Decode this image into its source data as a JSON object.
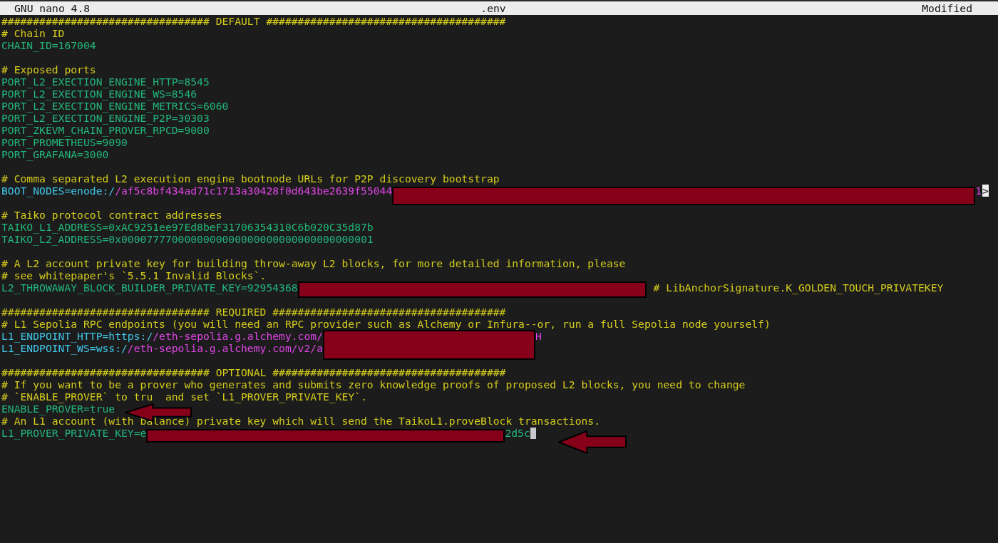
{
  "title_bar": {
    "app": "GNU nano 4.8",
    "file": ".env",
    "status": "Modified"
  },
  "lines": [
    {
      "kind": "text",
      "segments": [
        {
          "kind": "comment",
          "text": "################################# DEFAULT ######################################"
        }
      ]
    },
    {
      "kind": "text",
      "segments": [
        {
          "kind": "comment",
          "text": "# Chain ID"
        }
      ]
    },
    {
      "kind": "text",
      "segments": [
        {
          "kind": "setting",
          "text": "CHAIN_ID=167004"
        }
      ]
    },
    {
      "kind": "blank"
    },
    {
      "kind": "text",
      "segments": [
        {
          "kind": "comment",
          "text": "# Exposed ports"
        }
      ]
    },
    {
      "kind": "text",
      "segments": [
        {
          "kind": "setting",
          "text": "PORT_L2_EXECTION_ENGINE_HTTP=8545"
        }
      ]
    },
    {
      "kind": "text",
      "segments": [
        {
          "kind": "setting",
          "text": "PORT_L2_EXECTION_ENGINE_WS=8546"
        }
      ]
    },
    {
      "kind": "text",
      "segments": [
        {
          "kind": "setting",
          "text": "PORT_L2_EXECTION_ENGINE_METRICS=6060"
        }
      ]
    },
    {
      "kind": "text",
      "segments": [
        {
          "kind": "setting",
          "text": "PORT_L2_EXECTION_ENGINE_P2P=30303"
        }
      ]
    },
    {
      "kind": "text",
      "segments": [
        {
          "kind": "setting",
          "text": "PORT_ZKEVM_CHAIN_PROVER_RPCD=9000"
        }
      ]
    },
    {
      "kind": "text",
      "segments": [
        {
          "kind": "setting",
          "text": "PORT_PROMETHEUS=9090"
        }
      ]
    },
    {
      "kind": "text",
      "segments": [
        {
          "kind": "setting",
          "text": "PORT_GRAFANA=3000"
        }
      ]
    },
    {
      "kind": "blank"
    },
    {
      "kind": "text",
      "segments": [
        {
          "kind": "comment",
          "text": "# Comma separated L2 execution engine bootnode URLs for P2P discovery bootstrap"
        }
      ]
    },
    {
      "kind": "text",
      "segments": [
        {
          "kind": "url-key",
          "text": "BOOT_NODES=enode:/"
        },
        {
          "kind": "url",
          "text": "/af5c8bf434ad71c1713a30428f0d643be2639f55044"
        },
        {
          "kind": "redaction"
        },
        {
          "kind": "url",
          "text": "1"
        },
        {
          "kind": "more",
          "text": ">"
        }
      ]
    },
    {
      "kind": "blank"
    },
    {
      "kind": "text",
      "segments": [
        {
          "kind": "comment",
          "text": "# Taiko protocol contract addresses"
        }
      ]
    },
    {
      "kind": "text",
      "segments": [
        {
          "kind": "setting",
          "text": "TAIKO_L1_ADDRESS=0xAC9251ee97Ed8beF31706354310C6b020C35d87b"
        }
      ]
    },
    {
      "kind": "text",
      "segments": [
        {
          "kind": "setting",
          "text": "TAIKO_L2_ADDRESS=0x0000777700000000000000000000000000000001"
        }
      ]
    },
    {
      "kind": "blank"
    },
    {
      "kind": "text",
      "segments": [
        {
          "kind": "comment",
          "text": "# A L2 account private key for building throw-away L2 blocks, for more detailed information, please"
        }
      ]
    },
    {
      "kind": "text",
      "segments": [
        {
          "kind": "comment",
          "text": "# see whitepaper's `5.5.1 Invalid Blocks`."
        }
      ]
    },
    {
      "kind": "text",
      "segments": [
        {
          "kind": "setting",
          "text": "L2_THROWAWAY_BLOCK_BUILDER_PRIVATE_KEY=92954368"
        },
        {
          "kind": "redaction"
        },
        {
          "kind": "comment",
          "text": "# LibAnchorSignature.K_GOLDEN_TOUCH_PRIVATEKEY"
        }
      ]
    },
    {
      "kind": "blank"
    },
    {
      "kind": "text",
      "segments": [
        {
          "kind": "comment",
          "text": "################################# REQUIRED #####################################"
        }
      ]
    },
    {
      "kind": "text",
      "segments": [
        {
          "kind": "comment",
          "text": "# L1 Sepolia RPC endpoints (you will need an RPC provider such as Alchemy or Infura--or, run a full Sepolia node yourself)"
        }
      ]
    },
    {
      "kind": "text",
      "segments": [
        {
          "kind": "url-key",
          "text": "L1_ENDPOINT_HTTP=https:/"
        },
        {
          "kind": "url",
          "text": "/eth-sepolia.g.alchemy.com/"
        },
        {
          "kind": "redaction"
        },
        {
          "kind": "url",
          "text": "H"
        }
      ]
    },
    {
      "kind": "text",
      "segments": [
        {
          "kind": "url-key",
          "text": "L1_ENDPOINT_WS=wss:/"
        },
        {
          "kind": "url",
          "text": "/eth-sepolia.g.alchemy.com/v2/a"
        }
      ]
    },
    {
      "kind": "blank"
    },
    {
      "kind": "text",
      "segments": [
        {
          "kind": "comment",
          "text": "################################# OPTIONAL #####################################"
        }
      ]
    },
    {
      "kind": "text",
      "segments": [
        {
          "kind": "comment",
          "text": "# If you want to be a prover who generates and submits zero knowledge proofs of proposed L2 blocks, you need to change"
        }
      ]
    },
    {
      "kind": "text",
      "segments": [
        {
          "kind": "comment",
          "text": "# `ENABLE_PROVER` to tru"
        },
        {
          "kind": "spacer"
        },
        {
          "kind": "comment",
          "text": "and set `L1_PROVER_PRIVATE_KEY`."
        }
      ]
    },
    {
      "kind": "text",
      "segments": [
        {
          "kind": "setting",
          "text": "ENABLE_PROVER=true"
        }
      ]
    },
    {
      "kind": "text",
      "segments": [
        {
          "kind": "comment",
          "text": "# An L1 account (with balance) private key which will send the TaikoL1.proveBlock transactions."
        }
      ]
    },
    {
      "kind": "text",
      "segments": [
        {
          "kind": "setting",
          "text": "L1_PROVER_PRIVATE_KEY=e"
        },
        {
          "kind": "redaction"
        },
        {
          "kind": "setting",
          "text": "2d5c"
        },
        {
          "kind": "cursor"
        }
      ]
    }
  ]
}
